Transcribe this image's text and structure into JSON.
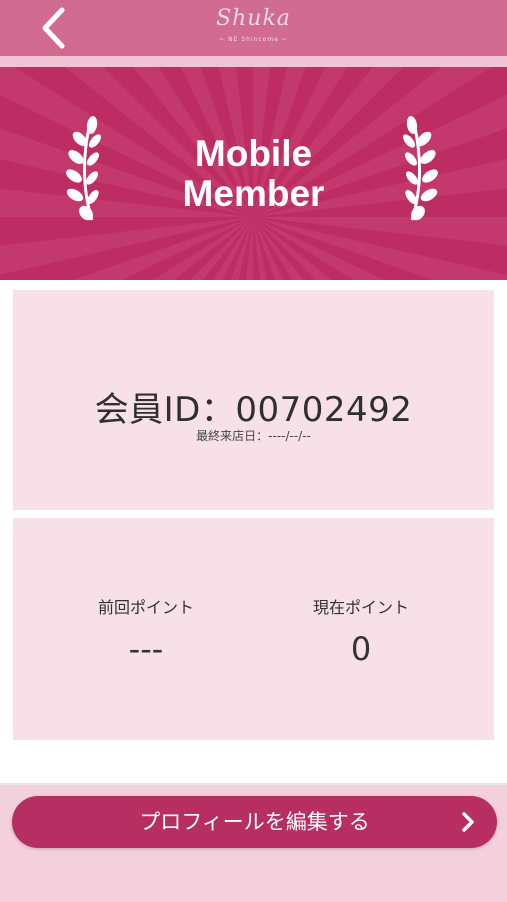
{
  "header": {
    "logo_text": "Shuka",
    "logo_sub": "~ NE Shincome ~",
    "back_icon": "chevron-left-icon"
  },
  "banner": {
    "title_line1": "Mobile",
    "title_line2": "Member",
    "bg_color": "#bd2c63"
  },
  "member": {
    "id_label": "会員ID：00702492",
    "last_visit_label": "最終来店日：----/--/--"
  },
  "points": {
    "previous_label": "前回ポイント",
    "previous_value": "---",
    "current_label": "現在ポイント",
    "current_value": "0"
  },
  "profile": {
    "edit_button_label": "プロフィールを編集する",
    "accent_color": "#b72f62"
  }
}
